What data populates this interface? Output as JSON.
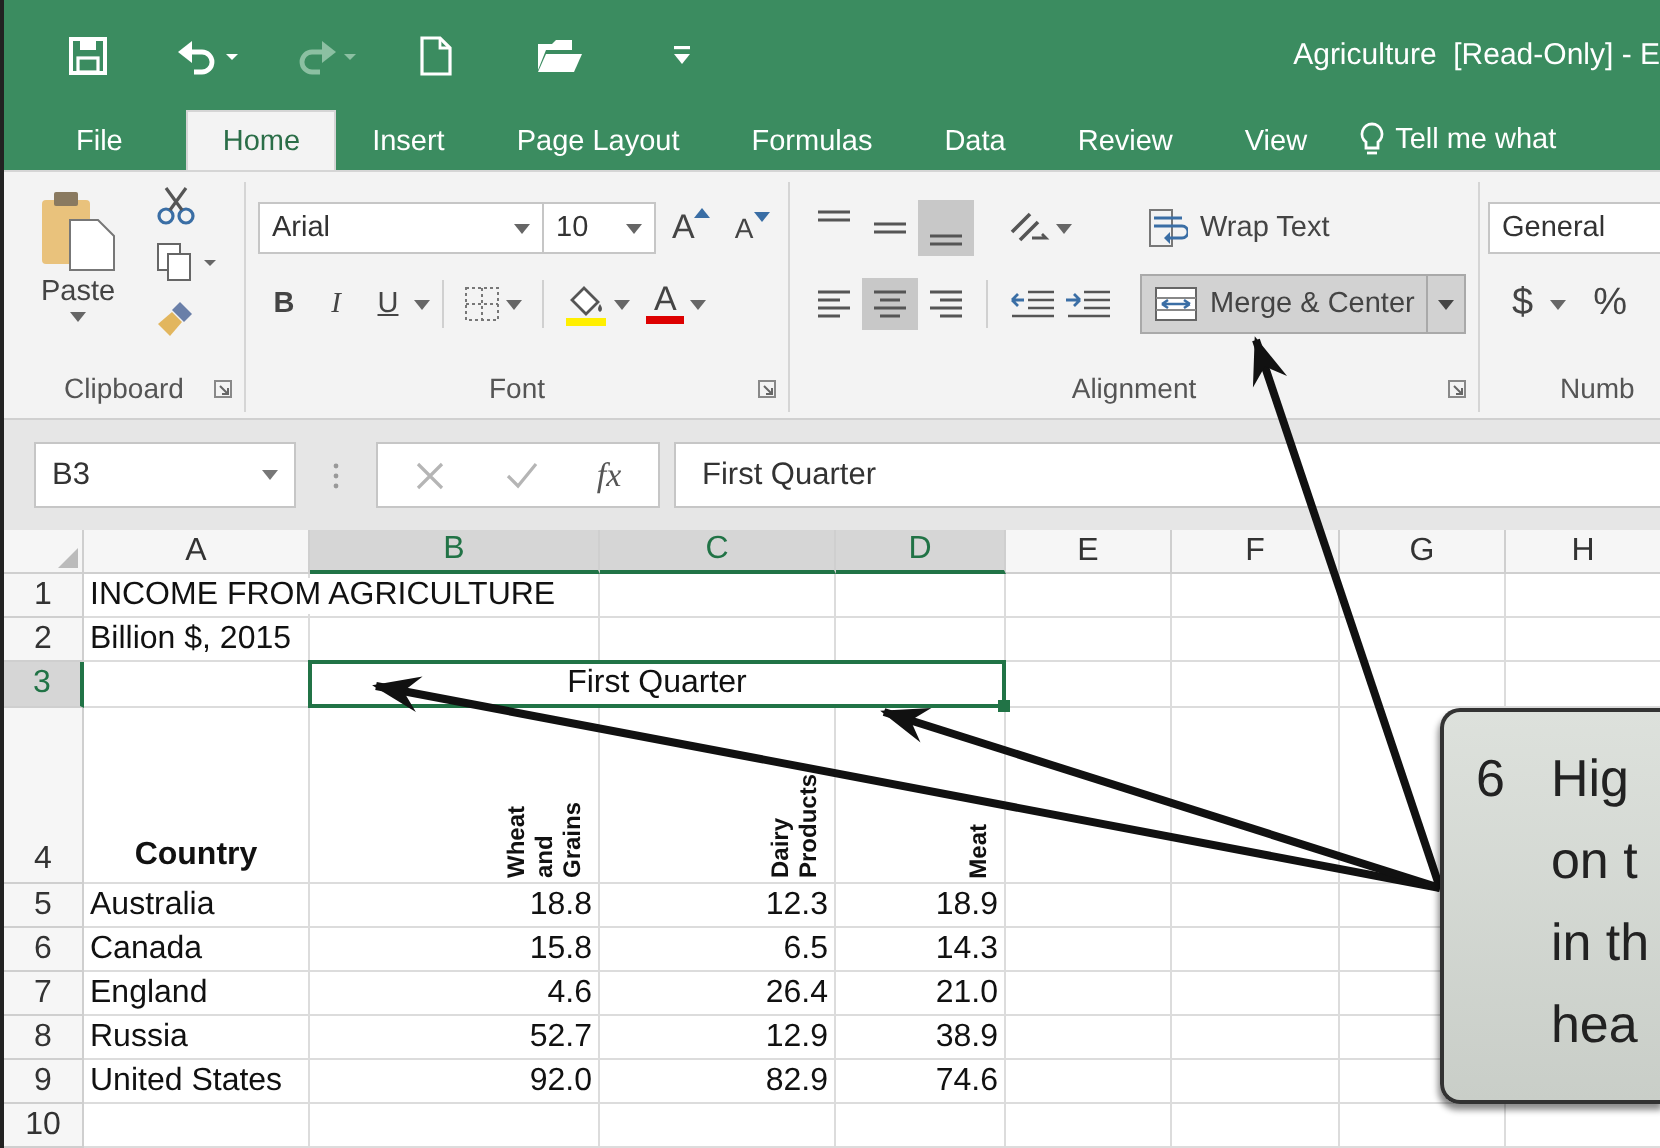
{
  "window": {
    "title": "Agriculture  [Read-Only] - E"
  },
  "quick_access": [
    {
      "kind": "save",
      "disabled": false
    },
    {
      "kind": "undo",
      "disabled": false
    },
    {
      "kind": "redo",
      "disabled": true
    },
    {
      "kind": "new",
      "disabled": false
    },
    {
      "kind": "open",
      "disabled": false
    },
    {
      "kind": "customize",
      "disabled": false
    }
  ],
  "tabs": [
    {
      "label": "File",
      "selected": false
    },
    {
      "label": "Home",
      "selected": true
    },
    {
      "label": "Insert",
      "selected": false
    },
    {
      "label": "Page Layout",
      "selected": false
    },
    {
      "label": "Formulas",
      "selected": false
    },
    {
      "label": "Data",
      "selected": false
    },
    {
      "label": "Review",
      "selected": false
    },
    {
      "label": "View",
      "selected": false
    }
  ],
  "tell_me": "Tell me what",
  "ribbon": {
    "clipboard": {
      "paste": "Paste",
      "label": "Clipboard"
    },
    "font": {
      "name": "Arial",
      "size": "10",
      "grow": "A",
      "shrink": "A",
      "styles": [
        "B",
        "I",
        "U"
      ],
      "font_color": "A",
      "label": "Font"
    },
    "alignment": {
      "vertical": [
        {
          "kind": "top",
          "selected": false
        },
        {
          "kind": "middle",
          "selected": false
        },
        {
          "kind": "bottom",
          "selected": true
        }
      ],
      "horizontal": [
        {
          "kind": "left",
          "selected": false
        },
        {
          "kind": "center",
          "selected": true
        },
        {
          "kind": "right",
          "selected": false
        }
      ],
      "wrap_text": "Wrap Text",
      "merge_center": "Merge & Center",
      "merge_highlighted": true,
      "label": "Alignment"
    },
    "number": {
      "format": "General",
      "currency": "$",
      "percent": "%",
      "label": "Numb"
    }
  },
  "formula_bar": {
    "name_box": "B3",
    "fx": "fx",
    "formula": "First Quarter"
  },
  "sheet": {
    "columns": [
      {
        "label": "A",
        "selected": false
      },
      {
        "label": "B",
        "selected": true
      },
      {
        "label": "C",
        "selected": true
      },
      {
        "label": "D",
        "selected": true
      },
      {
        "label": "E",
        "selected": false
      },
      {
        "label": "F",
        "selected": false
      },
      {
        "label": "G",
        "selected": false
      },
      {
        "label": "H",
        "selected": false
      }
    ],
    "rows": [
      {
        "number": "1",
        "selected": false,
        "kind": "text",
        "cells": [
          "INCOME FROM AGRICULTURE"
        ]
      },
      {
        "number": "2",
        "selected": false,
        "kind": "text",
        "cells": [
          "Billion $, 2015"
        ]
      },
      {
        "number": "3",
        "selected": true,
        "kind": "merged",
        "cells": [
          "",
          "First Quarter"
        ]
      },
      {
        "number": "4",
        "selected": false,
        "kind": "header",
        "cells": [
          "Country",
          "Wheat and Grains",
          "Dairy Products",
          "Meat"
        ]
      },
      {
        "number": "5",
        "selected": false,
        "kind": "data",
        "cells": [
          "Australia",
          "18.8",
          "12.3",
          "18.9"
        ]
      },
      {
        "number": "6",
        "selected": false,
        "kind": "data",
        "cells": [
          "Canada",
          "15.8",
          "6.5",
          "14.3"
        ]
      },
      {
        "number": "7",
        "selected": false,
        "kind": "data",
        "cells": [
          "England",
          "4.6",
          "26.4",
          "21.0"
        ]
      },
      {
        "number": "8",
        "selected": false,
        "kind": "data",
        "cells": [
          "Russia",
          "52.7",
          "12.9",
          "38.9"
        ]
      },
      {
        "number": "9",
        "selected": false,
        "kind": "data",
        "cells": [
          "United States",
          "92.0",
          "82.9",
          "74.6"
        ]
      },
      {
        "number": "10",
        "selected": false,
        "kind": "data",
        "cells": []
      }
    ]
  },
  "callout": {
    "number": "6",
    "lines": [
      "Hig",
      "on t",
      "in th",
      "hea"
    ]
  }
}
